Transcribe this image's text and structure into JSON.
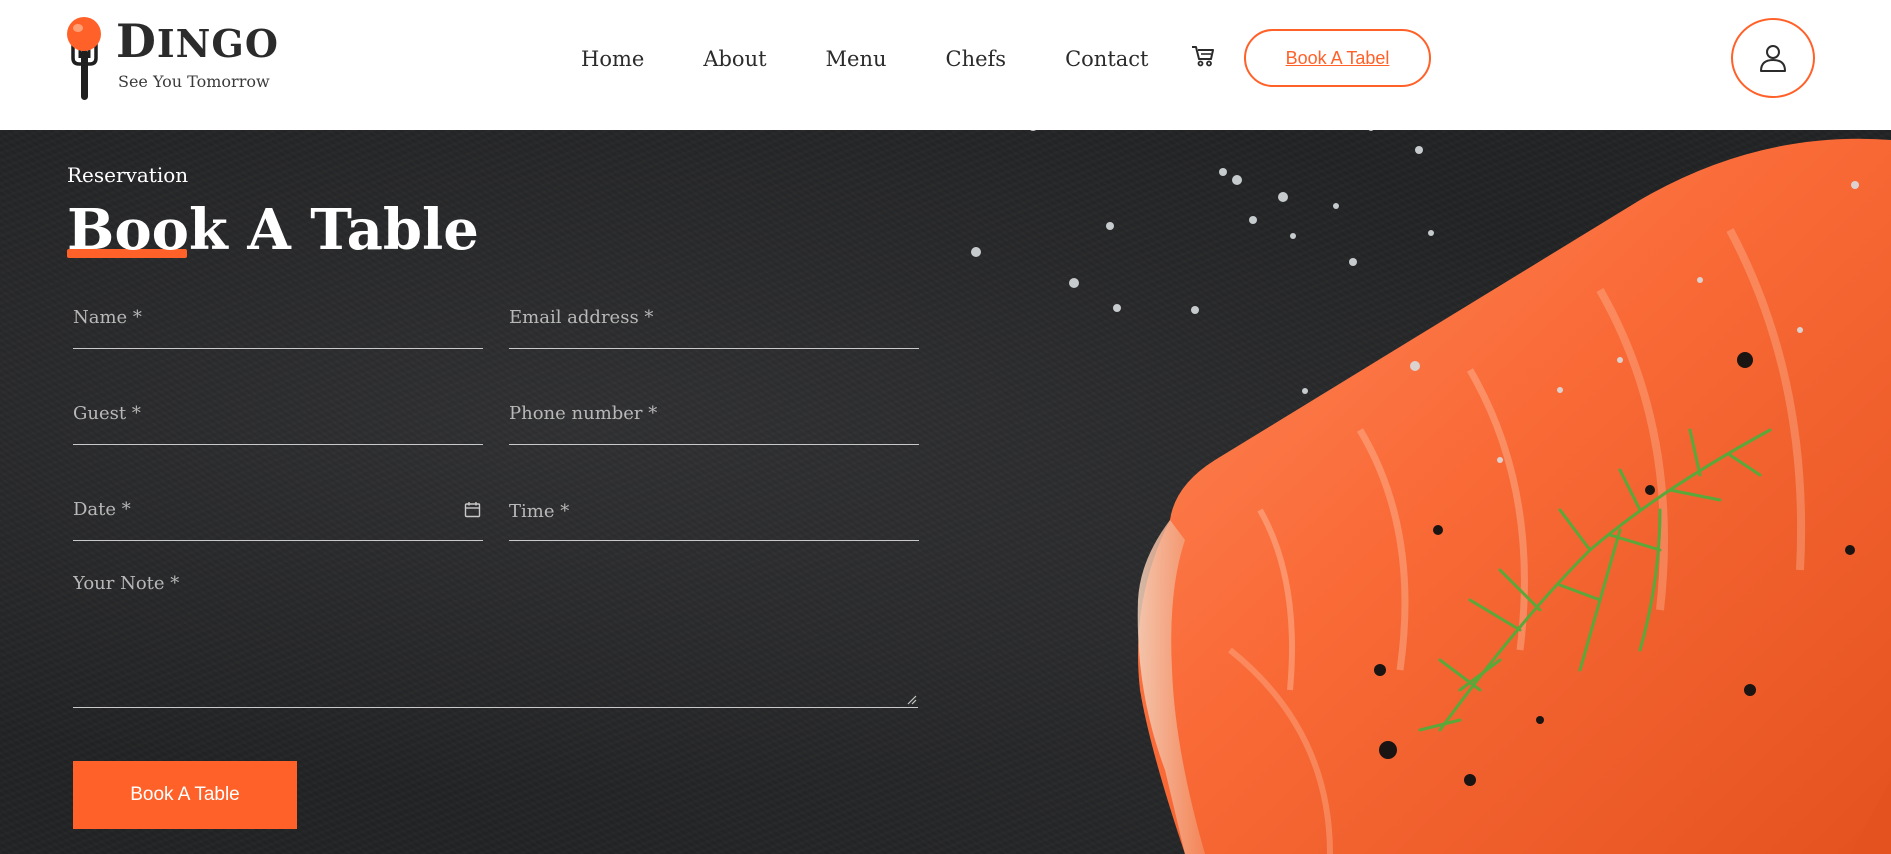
{
  "brand": {
    "name": "Dingo",
    "name_first": "D",
    "name_rest": "INGO",
    "tagline": "See You Tomorrow",
    "accent": "#ff6129"
  },
  "nav": {
    "items": [
      {
        "label": "Home"
      },
      {
        "label": "About"
      },
      {
        "label": "Menu"
      },
      {
        "label": "Chefs"
      },
      {
        "label": "Contact"
      }
    ],
    "cart_icon": "cart-icon",
    "book_label": "Book A Tabel",
    "user_icon": "user-icon"
  },
  "hero": {
    "eyebrow": "Reservation",
    "title": "Book A Table"
  },
  "form": {
    "name_placeholder": "Name *",
    "email_placeholder": "Email address *",
    "guest_placeholder": "Guest *",
    "phone_placeholder": "Phone number *",
    "date_placeholder": "Date *",
    "time_placeholder": "Time *",
    "note_placeholder": "Your Note *",
    "submit_label": "Book A Table",
    "date_icon": "calendar-icon"
  }
}
